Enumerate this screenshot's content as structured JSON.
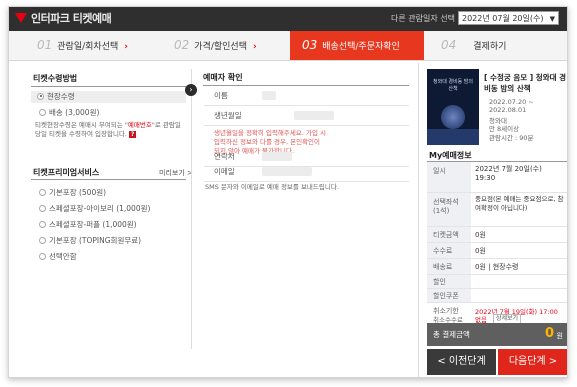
{
  "header": {
    "brand": "인터파크 티켓예매",
    "date_label": "다른 관람일자 선택",
    "date_value": "2022년 07월 20일(수)"
  },
  "steps": [
    {
      "num": "01",
      "label": "관람일/회차선택"
    },
    {
      "num": "02",
      "label": "가격/할인선택"
    },
    {
      "num": "03",
      "label": "배송선택/주문자확인"
    },
    {
      "num": "04",
      "label": "결제하기"
    }
  ],
  "receipt": {
    "title": "티켓수령방법",
    "options": [
      "현장수령",
      "배송 (3,000원)"
    ],
    "note_prefix": "티켓현장수령은 예매시 부여되는 \"",
    "note_red": "예매번호",
    "note_suffix": "\"로 관람일 당일 티켓을 수령하여 입장합니다.",
    "note_icon": "?"
  },
  "premium": {
    "title": "티켓프리미엄서비스",
    "more": "미리보기 >",
    "options": [
      "기본포장 (500원)",
      "스페셜포장-아이보리 (1,000원)",
      "스페셜포장-퍼플 (1,000원)",
      "기본포장 (TOPING회원무료)",
      "선택안함"
    ]
  },
  "booker": {
    "title": "예매자 확인",
    "rows": [
      "이름",
      "생년월일",
      "",
      "연락처",
      "이메일"
    ],
    "warning": "생년월일을 정확히 입력해주세요. 가입 시 입력하신 정보와 다를 경우, 본인확인이 되지 않아 예매가 불가합니다.",
    "sms": "SMS 문자와 이메일로 예매 정보를 보내드립니다."
  },
  "show": {
    "title": "[ 수정궁 음모 ] 청와대 경비동 밤의 산책",
    "poster_text": "청와대 경비동 밤의 산책",
    "dates": "2022.07.20 ~",
    "dates2": "2022.08.01",
    "venue": "청와대",
    "age": "만 8세이상",
    "runtime": "관람시간 : 90분"
  },
  "my": {
    "title": "My예매정보",
    "date_label": "일시",
    "date_value": "2022년 7월 20일(수)",
    "time_value": "19:30",
    "seat_label": "선택좌석",
    "seat_count": "(1석)",
    "seat_value": "중요점(본 예매는 중요점으로, 참여확정이 아닙니다)",
    "ticket_label": "티켓금액",
    "ticket_value": "0원",
    "fee_label": "수수료",
    "fee_value": "0원",
    "ship_label": "배송료",
    "ship_value": "0원 | 현장수령",
    "disc_label": "할인",
    "coupon_label": "할인쿠폰",
    "cancel_label": "취소기한",
    "cancel_value": "2022년 7월 19일(화) 17:00",
    "cancelfee_label": "취소수수료",
    "cancelfee_value": "없음",
    "cancelfee_btn": "상세보기",
    "total_label": "총 결제금액",
    "total_value": "0",
    "total_unit": "원"
  },
  "nav": {
    "prev": "< 이전단계",
    "next": "다음단계 >"
  }
}
